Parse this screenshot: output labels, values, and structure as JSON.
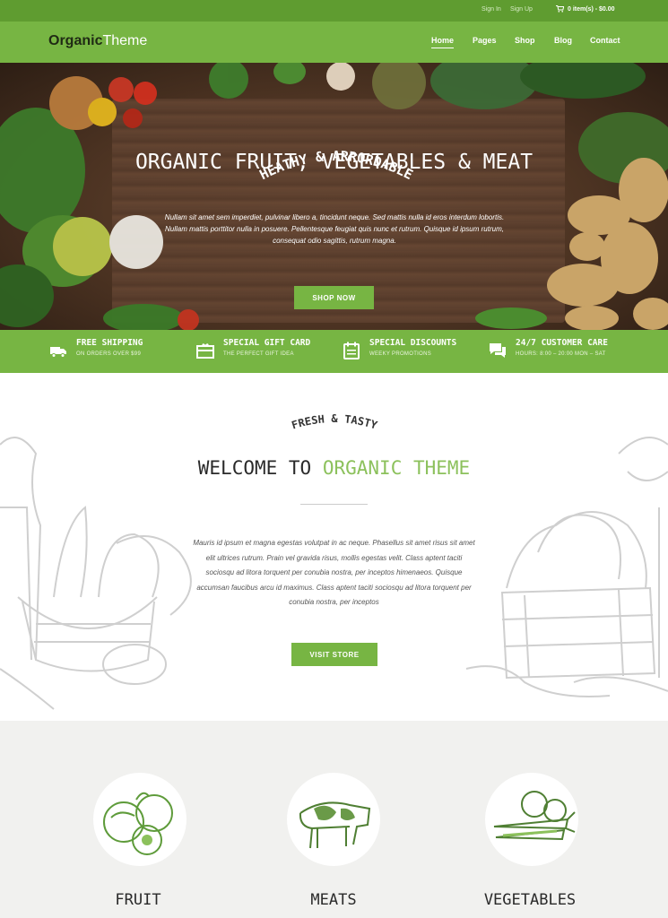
{
  "topbar": {
    "signin": "Sign In",
    "signup": "Sign Up",
    "cart": "0 item(s) - $0.00"
  },
  "logo": {
    "bold": "Organic",
    "light": "Theme"
  },
  "nav": {
    "items": [
      "Home",
      "Pages",
      "Shop",
      "Blog",
      "Contact"
    ],
    "active": "Home"
  },
  "hero": {
    "tagline": "HEATHY & ARRORDABLE",
    "title": "ORGANIC FRUIT, VEGETABLES & MEAT",
    "text": "Nullam sit amet sem imperdiet, pulvinar libero a, tincidunt neque. Sed mattis nulla id eros interdum lobortis. Nullam mattis porttitor nulla in posuere. Pellentesque feugiat quis nunc et rutrum. Quisque id ipsum rutrum, consequat odio sagittis, rutrum magna.",
    "button": "SHOP NOW"
  },
  "features": [
    {
      "icon": "truck-icon",
      "title": "FREE SHIPPING",
      "subtitle": "ON ORDERS OVER $99"
    },
    {
      "icon": "gift-card-icon",
      "title": "SPECIAL GIFT CARD",
      "subtitle": "THE PERFECT GIFT IDEA"
    },
    {
      "icon": "calendar-icon",
      "title": "SPECIAL DISCOUNTS",
      "subtitle": "WEEKY PROMOTIONS"
    },
    {
      "icon": "chat-icon",
      "title": "24/7 CUSTOMER CARE",
      "subtitle": "HOURS: 8:00 – 20:00 MON – SAT"
    }
  ],
  "welcome": {
    "tagline": "FRESH & TASTY",
    "title_plain": "WELCOME TO ",
    "title_green": "ORGANIC THEME",
    "text": "Mauris id ipsum et magna egestas volutpat in ac neque. Phasellus sit amet risus sit amet elit ultrices rutrum. Prain vel gravida risus, mollis egestas velit. Class aptent taciti sociosqu ad litora torquent per conubia nostra, per inceptos himenaeos. Quisque accumsan faucibus arcu id maximus. Class aptent taciti sociosqu ad litora torquent per conubia nostra, per inceptos",
    "button": "VISIT STORE"
  },
  "categories": [
    {
      "label": "FRUIT",
      "icon": "fruit-icon"
    },
    {
      "label": "MEATS",
      "icon": "cow-icon"
    },
    {
      "label": "VEGETABLES",
      "icon": "vegetables-icon"
    }
  ],
  "colors": {
    "green": "#77b543",
    "dark_green": "#5f9c30",
    "light_green_text": "#8cc15c"
  }
}
